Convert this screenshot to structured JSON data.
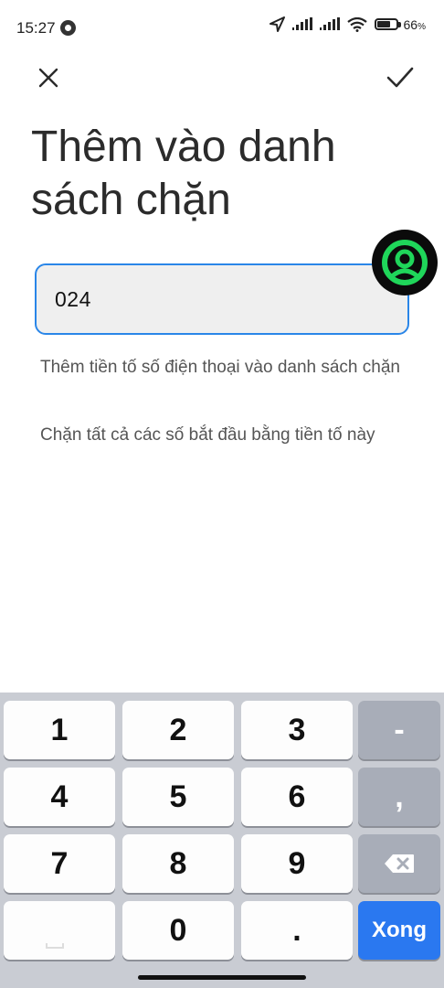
{
  "status": {
    "time": "15:27",
    "battery_level": "66",
    "battery_unit": "%"
  },
  "header": {
    "title": "Thêm vào danh sách chặn"
  },
  "input": {
    "value": "024"
  },
  "options": [
    "Thêm tiền tố số điện thoại vào danh sách chặn",
    "Chặn tất cả các số bắt đầu bằng tiền tố này"
  ],
  "keyboard": {
    "k1": "1",
    "k2": "2",
    "k3": "3",
    "minus": "-",
    "k4": "4",
    "k5": "5",
    "k6": "6",
    "comma": ",",
    "k7": "7",
    "k8": "8",
    "k9": "9",
    "k0": "0",
    "dot": ".",
    "done": "Xong"
  },
  "colors": {
    "accent": "#2a86e8",
    "done_key": "#2a78f0",
    "floating_button_ring": "#1fd65a"
  }
}
